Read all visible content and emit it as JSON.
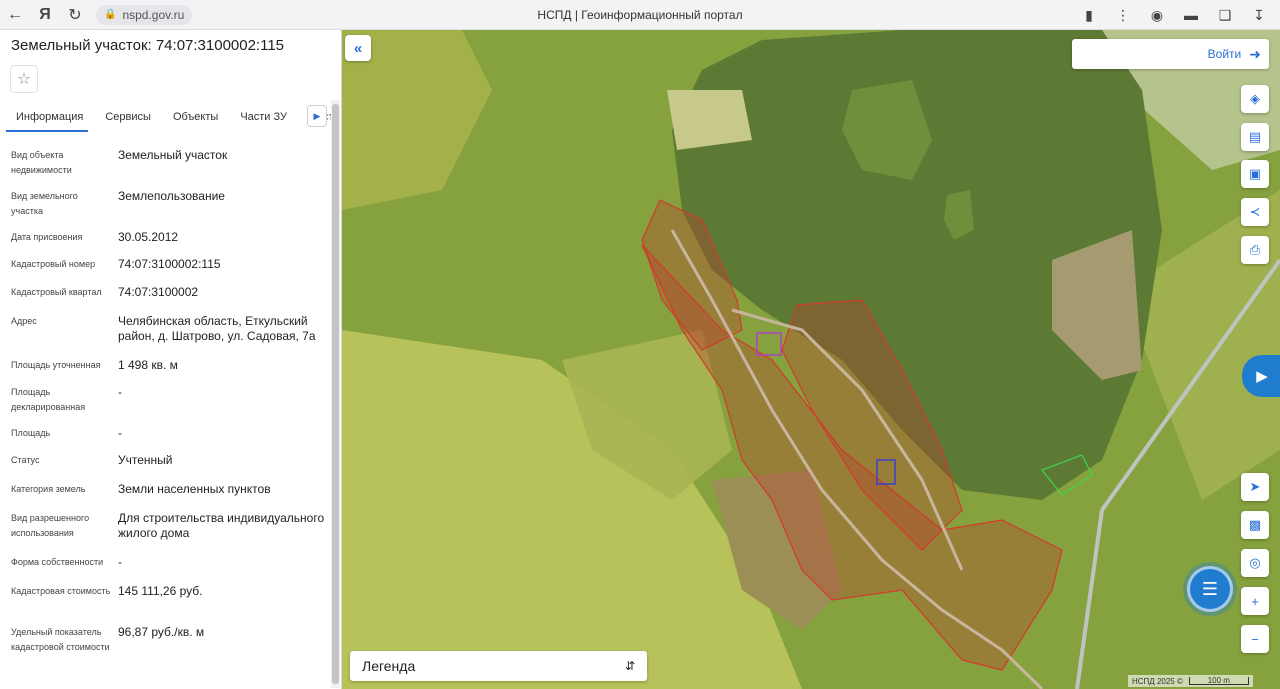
{
  "browser": {
    "url": "nspd.gov.ru",
    "tab_title": "НСПД | Геоинформационный портал"
  },
  "panel": {
    "title": "Земельный участок: 74:07:3100002:115",
    "tabs": [
      {
        "label": "Информация",
        "active": true
      },
      {
        "label": "Сервисы"
      },
      {
        "label": "Объекты"
      },
      {
        "label": "Части ЗУ"
      },
      {
        "label": "Соста"
      }
    ],
    "rows": [
      {
        "label": "Вид объекта недвижимости",
        "value": "Земельный участок"
      },
      {
        "label": "Вид земельного участка",
        "value": "Землепользование"
      },
      {
        "label": "Дата присвоения",
        "value": "30.05.2012"
      },
      {
        "label": "Кадастровый номер",
        "value": "74:07:3100002:115"
      },
      {
        "label": "Кадастровый квартал",
        "value": "74:07:3100002"
      },
      {
        "label": "Адрес",
        "value": "Челябинская область, Еткульский район, д. Шатрово, ул. Садовая, 7а"
      },
      {
        "label": "Площадь уточненная",
        "value": "1 498 кв. м"
      },
      {
        "label": "Площадь декларированная",
        "value": "-"
      },
      {
        "label": "Площадь",
        "value": "-"
      },
      {
        "label": "Статус",
        "value": "Учтенный"
      },
      {
        "label": "Категория земель",
        "value": "Земли населенных пунктов"
      },
      {
        "label": "Вид разрешенного использования",
        "value": "Для строительства индивидуального жилого дома"
      },
      {
        "label": "Форма собственности",
        "value": "-"
      },
      {
        "label": "Кадастровая стоимость",
        "value": "145 111,26 руб."
      },
      {
        "label": "Удельный показатель кадастровой стоимости",
        "value": "96,87 руб./кв. м"
      }
    ]
  },
  "map": {
    "login_label": "Войти",
    "legend_label": "Легенда",
    "attribution": "НСПД 2025 ©",
    "scale_label": "100 m",
    "tools": [
      "layers-icon",
      "ruler-icon",
      "select-area-icon",
      "share-icon",
      "print-icon",
      "locate-icon",
      "minimap-icon",
      "geo-search-icon",
      "zoom-in-icon",
      "zoom-out-icon"
    ],
    "colors": {
      "lake": "#5d7a35",
      "parcel_stroke": "#d43a2a",
      "accent": "#1f7ccf"
    }
  }
}
